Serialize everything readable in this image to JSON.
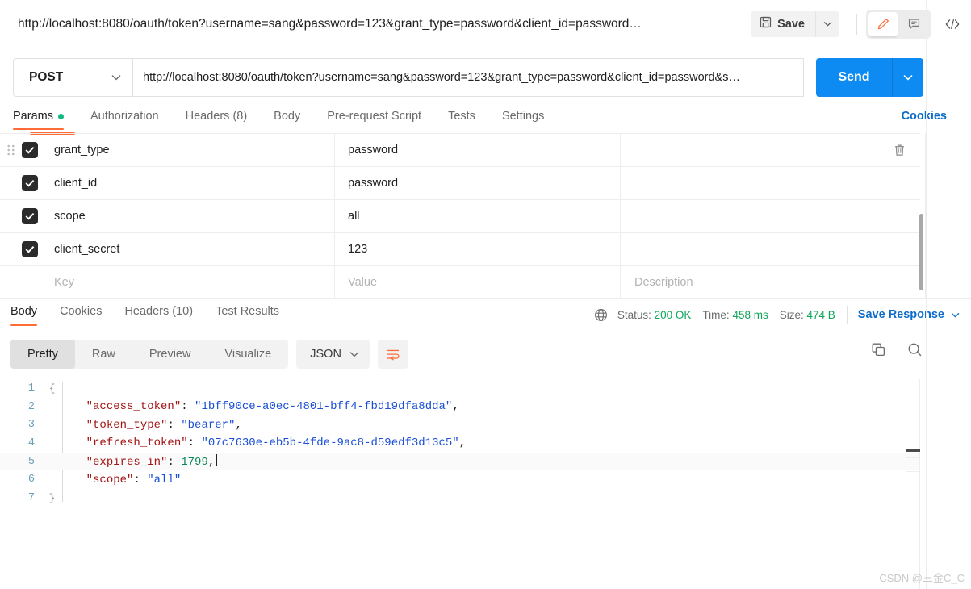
{
  "header": {
    "request_title": "http://localhost:8080/oauth/token?username=sang&password=123&grant_type=password&client_id=password…",
    "save_label": "Save",
    "save_caret_icon": "chevron-down-icon",
    "save_disk_icon": "floppy-disk-icon",
    "edit_icon": "pencil-icon",
    "comment_icon": "comment-icon",
    "code_icon": "code-brackets-icon"
  },
  "request": {
    "method": "POST",
    "method_caret_icon": "chevron-down-icon",
    "url": "http://localhost:8080/oauth/token?username=sang&password=123&grant_type=password&client_id=password&s…",
    "send_label": "Send",
    "send_caret_icon": "chevron-down-icon"
  },
  "request_tabs": {
    "items": [
      {
        "label": "Params",
        "active": true,
        "dot": true
      },
      {
        "label": "Authorization",
        "active": false,
        "dot": false
      },
      {
        "label": "Headers (8)",
        "active": false,
        "dot": false
      },
      {
        "label": "Body",
        "active": false,
        "dot": false
      },
      {
        "label": "Pre-request Script",
        "active": false,
        "dot": false
      },
      {
        "label": "Tests",
        "active": false,
        "dot": false
      },
      {
        "label": "Settings",
        "active": false,
        "dot": false
      }
    ],
    "cookies_label": "Cookies"
  },
  "params_table": {
    "columns": [
      "Key",
      "Value",
      "Description"
    ],
    "rows": [
      {
        "checked": true,
        "key": "grant_type",
        "value": "password",
        "description": "",
        "handle": true,
        "trash": true
      },
      {
        "checked": true,
        "key": "client_id",
        "value": "password",
        "description": "",
        "handle": false,
        "trash": false
      },
      {
        "checked": true,
        "key": "scope",
        "value": "all",
        "description": "",
        "handle": false,
        "trash": false
      },
      {
        "checked": true,
        "key": "client_secret",
        "value": "123",
        "description": "",
        "handle": false,
        "trash": false
      }
    ],
    "placeholder_row": {
      "key": "Key",
      "value": "Value",
      "description": "Description"
    },
    "trash_icon": "trash-icon",
    "drag_icon": "drag-handle-icon"
  },
  "response_tabs": {
    "items": [
      {
        "label": "Body",
        "active": true
      },
      {
        "label": "Cookies",
        "active": false
      },
      {
        "label": "Headers (10)",
        "active": false
      },
      {
        "label": "Test Results",
        "active": false
      }
    ],
    "globe_icon": "globe-icon",
    "status_label": "Status:",
    "status_value": "200 OK",
    "time_label": "Time:",
    "time_value": "458 ms",
    "size_label": "Size:",
    "size_value": "474 B",
    "save_response_label": "Save Response",
    "save_response_caret_icon": "chevron-down-icon"
  },
  "body_toolbar": {
    "views": [
      {
        "label": "Pretty",
        "active": true
      },
      {
        "label": "Raw",
        "active": false
      },
      {
        "label": "Preview",
        "active": false
      },
      {
        "label": "Visualize",
        "active": false
      }
    ],
    "format": "JSON",
    "format_caret_icon": "chevron-down-icon",
    "wrap_icon": "word-wrap-icon",
    "copy_icon": "copy-icon",
    "search_icon": "search-icon"
  },
  "response_body": {
    "language": "json",
    "lines": [
      {
        "num": "1",
        "fold": "{",
        "indent": 0,
        "tokens": []
      },
      {
        "num": "2",
        "fold": "",
        "indent": 1,
        "tokens": [
          {
            "t": "\"access_token\"",
            "c": "k"
          },
          {
            "t": ": ",
            "c": "p"
          },
          {
            "t": "\"1bff90ce-a0ec-4801-bff4-fbd19dfa8dda\"",
            "c": "s"
          },
          {
            "t": ",",
            "c": "p"
          }
        ]
      },
      {
        "num": "3",
        "fold": "",
        "indent": 1,
        "tokens": [
          {
            "t": "\"token_type\"",
            "c": "k"
          },
          {
            "t": ": ",
            "c": "p"
          },
          {
            "t": "\"bearer\"",
            "c": "s"
          },
          {
            "t": ",",
            "c": "p"
          }
        ]
      },
      {
        "num": "4",
        "fold": "",
        "indent": 1,
        "tokens": [
          {
            "t": "\"refresh_token\"",
            "c": "k"
          },
          {
            "t": ": ",
            "c": "p"
          },
          {
            "t": "\"07c7630e-eb5b-4fde-9ac8-d59edf3d13c5\"",
            "c": "s"
          },
          {
            "t": ",",
            "c": "p"
          }
        ]
      },
      {
        "num": "5",
        "fold": "",
        "indent": 1,
        "highlight": true,
        "caret": true,
        "tokens": [
          {
            "t": "\"expires_in\"",
            "c": "k"
          },
          {
            "t": ": ",
            "c": "p"
          },
          {
            "t": "1799",
            "c": "n"
          },
          {
            "t": ",",
            "c": "p"
          }
        ]
      },
      {
        "num": "6",
        "fold": "",
        "indent": 1,
        "tokens": [
          {
            "t": "\"scope\"",
            "c": "k"
          },
          {
            "t": ": ",
            "c": "p"
          },
          {
            "t": "\"all\"",
            "c": "s"
          }
        ]
      },
      {
        "num": "7",
        "fold": "}",
        "indent": 0,
        "tokens": []
      }
    ]
  },
  "watermark": {
    "text": "CSDN @三金C_C"
  },
  "colors": {
    "accent_orange": "#ff6c37",
    "send_blue": "#0d8bf2",
    "link_blue": "#0b6bcb",
    "status_green": "#10a65a",
    "dot_green": "#10b981"
  }
}
